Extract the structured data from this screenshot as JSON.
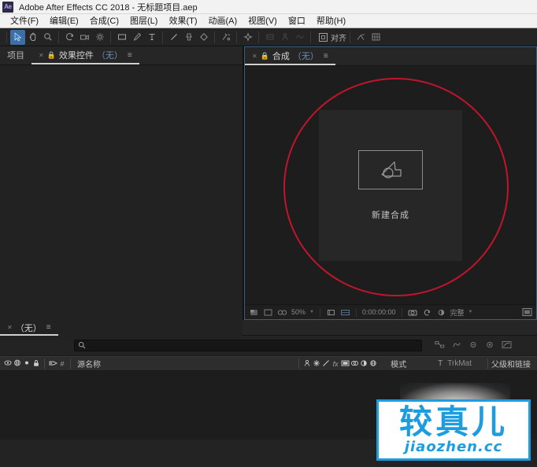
{
  "window": {
    "app_badge": "Ae",
    "title": "Adobe After Effects CC 2018 - 无标题项目.aep"
  },
  "menubar": {
    "items": [
      {
        "label": "文件(F)"
      },
      {
        "label": "编辑(E)"
      },
      {
        "label": "合成(C)"
      },
      {
        "label": "图层(L)"
      },
      {
        "label": "效果(T)"
      },
      {
        "label": "动画(A)"
      },
      {
        "label": "视图(V)"
      },
      {
        "label": "窗口"
      },
      {
        "label": "帮助(H)"
      }
    ]
  },
  "toolbar": {
    "align_label": "对齐",
    "tools": [
      {
        "name": "selection-tool-icon",
        "glyph": "➤"
      },
      {
        "name": "hand-tool-icon",
        "glyph": "✋"
      },
      {
        "name": "zoom-tool-icon",
        "glyph": "🔍"
      },
      {
        "name": "rotation-tool-icon",
        "glyph": "↺"
      },
      {
        "name": "camera-tool-icon",
        "glyph": "🎥"
      },
      {
        "name": "pan-behind-tool-icon",
        "glyph": "✥"
      },
      {
        "name": "shape-tool-icon",
        "glyph": "▭"
      },
      {
        "name": "pen-tool-icon",
        "glyph": "✒"
      },
      {
        "name": "text-tool-icon",
        "glyph": "T"
      },
      {
        "name": "brush-tool-icon",
        "glyph": "╱"
      },
      {
        "name": "clone-stamp-tool-icon",
        "glyph": "⚱"
      },
      {
        "name": "eraser-tool-icon",
        "glyph": "◆"
      },
      {
        "name": "roto-brush-tool-icon",
        "glyph": "✂"
      },
      {
        "name": "puppet-pin-tool-icon",
        "glyph": "✦"
      },
      {
        "name": "workspace-icon-a",
        "glyph": "▦"
      },
      {
        "name": "workspace-icon-b",
        "glyph": "人"
      },
      {
        "name": "workspace-icon-c",
        "glyph": "∿"
      },
      {
        "name": "snapping-icon",
        "glyph": "⌁"
      },
      {
        "name": "grid-icon",
        "glyph": "▨"
      }
    ]
  },
  "left_panel": {
    "tabs": [
      {
        "label": "项目",
        "selected": false,
        "has_close": false,
        "has_lock": false,
        "has_menu": false
      },
      {
        "label": "效果控件",
        "suffix": "（无）",
        "selected": true,
        "has_close": true,
        "has_lock": true,
        "has_menu": true
      }
    ]
  },
  "comp_panel": {
    "tabs": [
      {
        "label": "合成",
        "suffix": "（无）",
        "selected": true,
        "has_close": true,
        "has_lock": true,
        "has_menu": true
      }
    ],
    "new_composition": {
      "label": "新建合成",
      "icon": "new-composition-icon"
    },
    "viewer_bar": {
      "magnification": "50%",
      "timecode": "0:00:00:00",
      "quality": "完整",
      "icons": [
        {
          "name": "toggle-transparency-grid-icon",
          "glyph": "▣"
        },
        {
          "name": "toggle-mask-icon",
          "glyph": "▢"
        },
        {
          "name": "toggle-3d-view-icon",
          "glyph": "👓"
        },
        {
          "name": "region-of-interest-icon",
          "glyph": "⬚"
        },
        {
          "name": "grid-guides-icon",
          "glyph": "▦"
        },
        {
          "name": "take-snapshot-icon",
          "glyph": "📷"
        },
        {
          "name": "show-snapshot-icon",
          "glyph": "♻"
        },
        {
          "name": "show-channel-icon",
          "glyph": "◑"
        },
        {
          "name": "timeline-switch-icon",
          "glyph": "▣"
        }
      ]
    }
  },
  "timeline_panel": {
    "tabs": [
      {
        "label": "（无）",
        "selected": true,
        "has_close": true,
        "has_menu": true
      }
    ],
    "search": {
      "placeholder": "",
      "value": "",
      "icon": "search-icon"
    },
    "toolbar_icons": [
      {
        "name": "composition-mini-flowchart-icon",
        "glyph": "⛓"
      },
      {
        "name": "draft-3d-icon",
        "glyph": "◔"
      },
      {
        "name": "hide-shy-layers-icon",
        "glyph": "✦"
      },
      {
        "name": "motion-blur-icon",
        "glyph": "◉"
      },
      {
        "name": "graph-editor-icon",
        "glyph": "◪"
      }
    ],
    "columns": {
      "switch_icons": [
        {
          "name": "video-switch-icon",
          "glyph": "👁"
        },
        {
          "name": "audio-switch-icon",
          "glyph": "◍"
        },
        {
          "name": "solo-switch-icon",
          "glyph": "◉"
        },
        {
          "name": "lock-switch-icon",
          "glyph": "🔒"
        },
        {
          "name": "label-color-icon",
          "glyph": "🏷"
        },
        {
          "name": "layer-number-icon",
          "glyph": "#"
        }
      ],
      "source_name": "源名称",
      "switches_icons": [
        {
          "name": "shy-icon",
          "glyph": "♟"
        },
        {
          "name": "collapse-transformations-icon",
          "glyph": "✳"
        },
        {
          "name": "quality-icon",
          "glyph": "╲"
        },
        {
          "name": "effects-icon",
          "glyph": "fx"
        },
        {
          "name": "frame-blending-icon",
          "glyph": "▤"
        },
        {
          "name": "motion-blur-switch-icon",
          "glyph": "◍"
        },
        {
          "name": "adjustment-layer-icon",
          "glyph": "◐"
        },
        {
          "name": "3d-layer-icon",
          "glyph": "◈"
        }
      ],
      "mode": "模式",
      "trkmat_t": "T",
      "trkmat": "TrkMat",
      "parent_link": "父级和链接"
    }
  },
  "annotation": {
    "shape": "ellipse",
    "color": "#c0152b"
  },
  "watermark": {
    "cn_text": "较真儿",
    "en_text": "jiaozhen.cc",
    "color": "#1b9de0"
  }
}
